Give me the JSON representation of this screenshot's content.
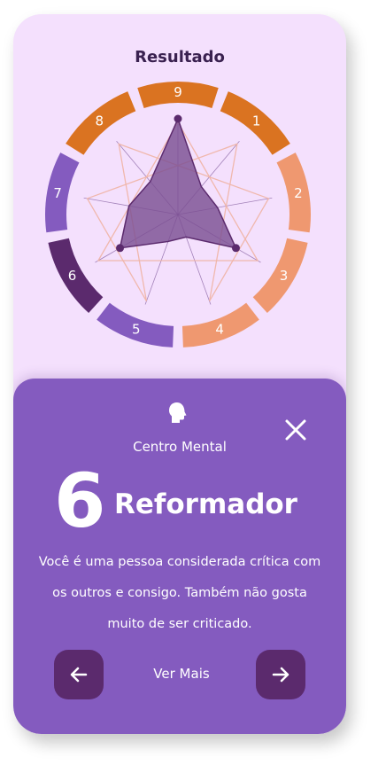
{
  "header": {
    "title": "Resultado"
  },
  "wheel": {
    "segments": [
      {
        "label": "9",
        "color": "#da7321"
      },
      {
        "label": "1",
        "color": "#da7321"
      },
      {
        "label": "2",
        "color": "#ef9870"
      },
      {
        "label": "3",
        "color": "#ef9870"
      },
      {
        "label": "4",
        "color": "#ef9870"
      },
      {
        "label": "5",
        "color": "#845bbf"
      },
      {
        "label": "6",
        "color": "#5b2a6d"
      },
      {
        "label": "7",
        "color": "#845bbf"
      },
      {
        "label": "8",
        "color": "#da7321"
      }
    ],
    "scores": [
      1.0,
      0.38,
      0.42,
      0.7,
      0.25,
      0.3,
      0.7,
      0.52,
      0.45
    ],
    "polygon_color": "#7b4f93",
    "star_color": "#efb4a4"
  },
  "card": {
    "center_label": "Centro Mental",
    "number": "6",
    "type_name": "Reformador",
    "description": "Você é uma pessoa considerada crítica com os outros e consigo. Também não gosta muito de ser criticado.",
    "more_label": "Ver Mais",
    "icons": {
      "close": "close-icon",
      "head": "head-icon",
      "prev": "arrow-left-icon",
      "next": "arrow-right-icon"
    }
  }
}
